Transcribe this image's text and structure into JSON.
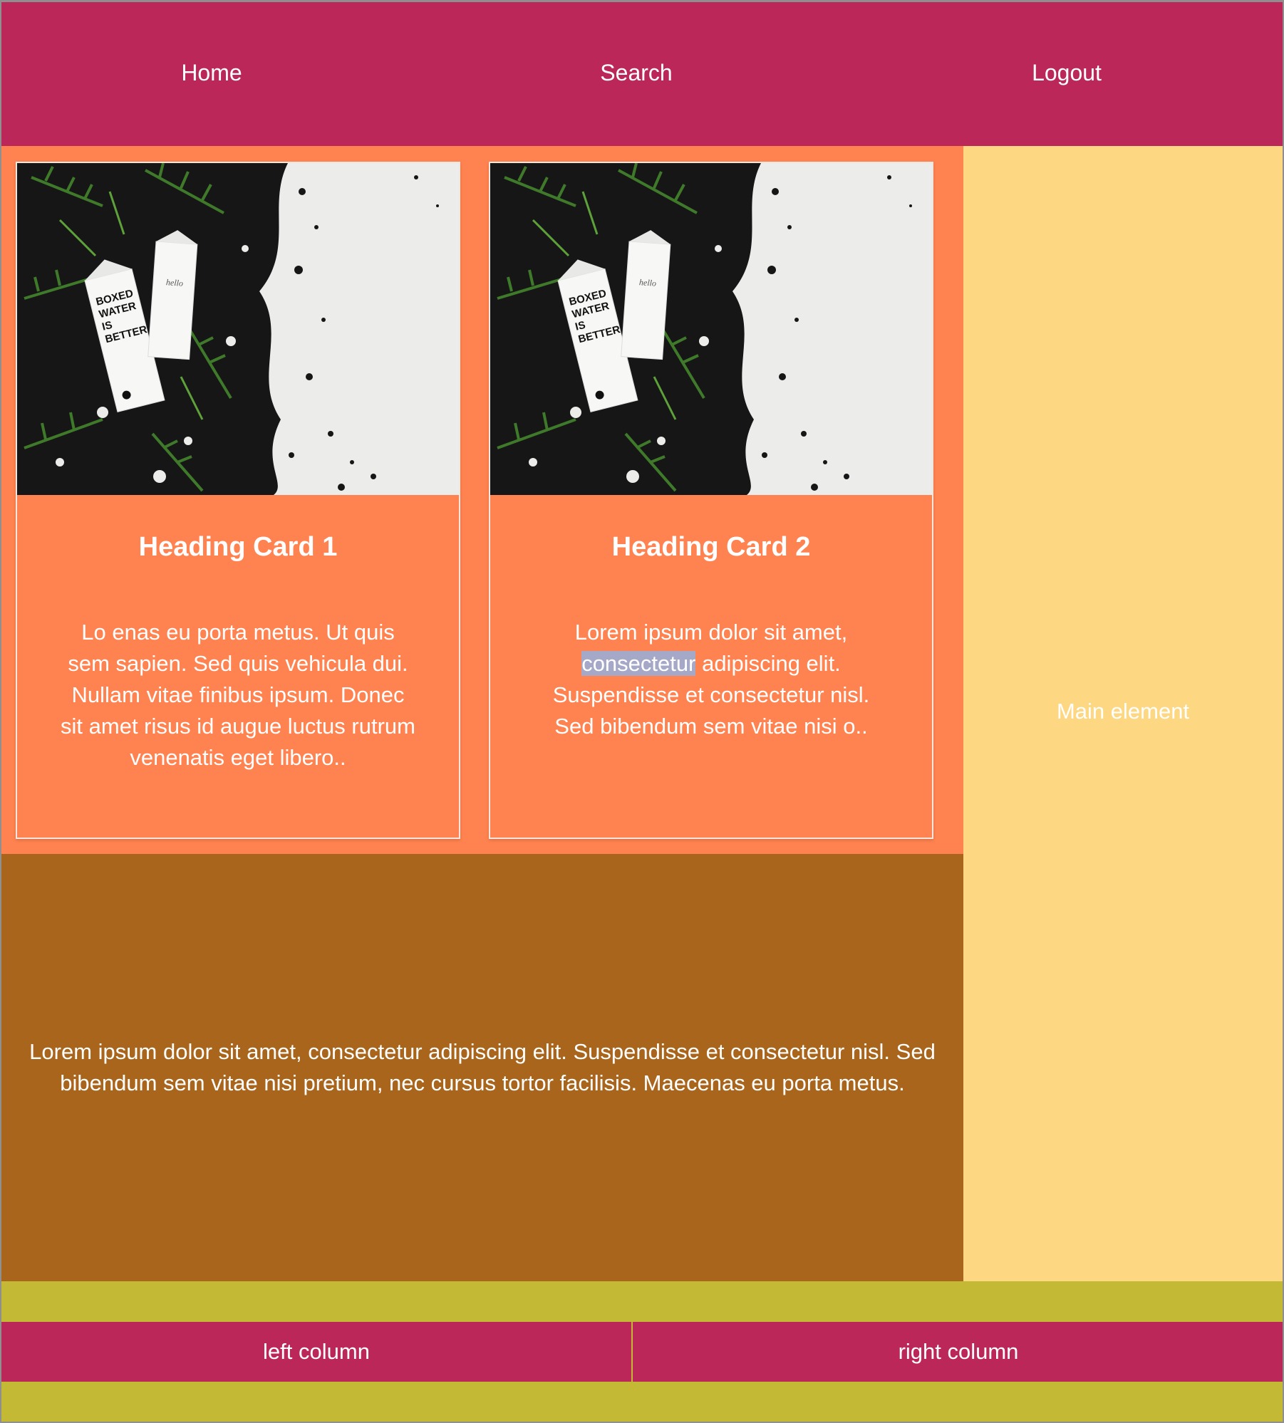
{
  "nav": {
    "home": "Home",
    "search": "Search",
    "logout": "Logout"
  },
  "cards": [
    {
      "heading": "Heading Card 1",
      "text": "Lo enas eu porta metus. Ut quis sem sapien. Sed quis vehicula dui. Nullam vitae finibus ipsum. Donec sit amet risus id augue luctus rutrum venenatis eget libero..",
      "image_icon": "boxed-water-image"
    },
    {
      "heading": "Heading Card 2",
      "text_before": "Lorem ipsum dolor sit amet,",
      "text_highlight": "consectetur",
      "text_after": "adipiscing elit. Suspendisse et consectetur nisl. Sed bibendum sem vitae nisi o..",
      "image_icon": "boxed-water-image"
    }
  ],
  "content": {
    "text": "Lorem ipsum dolor sit amet, consectetur adipiscing elit. Suspendisse et consectetur nisl. Sed bibendum sem vitae nisi pretium, nec cursus tortor facilisis. Maecenas eu porta metus."
  },
  "aside": {
    "label": "Main element"
  },
  "footer": {
    "left": "left column",
    "right": "right column"
  },
  "colors": {
    "nav": "#bc2759",
    "cards_bg": "#ff8350",
    "content_bg": "#aa651c",
    "aside_bg": "#fed783",
    "page_bg": "#c3b935",
    "highlight": "#a6a8c8"
  }
}
